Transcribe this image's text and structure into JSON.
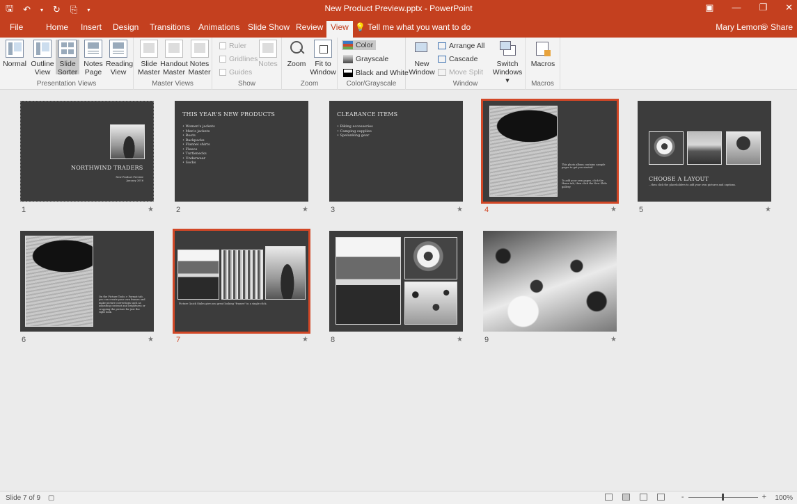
{
  "title_bar": {
    "title": "New Product Preview.pptx - PowerPoint",
    "qat_icons": [
      "save-icon",
      "undo-icon",
      "redo-icon",
      "start-from-beginning-icon",
      "customize-qat-icon"
    ],
    "qat_glyphs": {
      "save": "🖫",
      "undo": "↶",
      "undo_more": "▾",
      "redo": "↻",
      "present": "⎘",
      "customize": "▾"
    },
    "win_glyphs": {
      "ribbon": "▣",
      "minimize": "—",
      "restore": "❐",
      "close": "✕"
    }
  },
  "tabs": {
    "items": [
      "File",
      "Home",
      "Insert",
      "Design",
      "Transitions",
      "Animations",
      "Slide Show",
      "Review",
      "View"
    ],
    "active": "View",
    "tell_me": "Tell me what you want to do",
    "user": "Mary Lemons",
    "share": "Share"
  },
  "ribbon": {
    "presentation_views": {
      "label": "Presentation Views",
      "normal": "Normal",
      "outline": [
        "Outline",
        "View"
      ],
      "slide_sorter": [
        "Slide",
        "Sorter"
      ],
      "notes_page": [
        "Notes",
        "Page"
      ],
      "reading": [
        "Reading",
        "View"
      ]
    },
    "master_views": {
      "label": "Master Views",
      "slide": [
        "Slide",
        "Master"
      ],
      "handout": [
        "Handout",
        "Master"
      ],
      "notes": [
        "Notes",
        "Master"
      ]
    },
    "show": {
      "label": "Show",
      "ruler": "Ruler",
      "gridlines": "Gridlines",
      "guides": "Guides",
      "notes": "Notes"
    },
    "zoom": {
      "label": "Zoom",
      "zoom": "Zoom",
      "fit": [
        "Fit to",
        "Window"
      ]
    },
    "color_grayscale": {
      "label": "Color/Grayscale",
      "color": "Color",
      "grayscale": "Grayscale",
      "bw": "Black and White"
    },
    "window": {
      "label": "Window",
      "new_window": [
        "New",
        "Window"
      ],
      "arrange_all": "Arrange All",
      "cascade": "Cascade",
      "move_split": "Move Split",
      "switch": [
        "Switch",
        "Windows ▾"
      ]
    },
    "macros": {
      "label": "Macros",
      "macros": "Macros"
    }
  },
  "slides": [
    {
      "number": "1",
      "title": "NORTHWIND TRADERS",
      "subtitle1": "New Product Preview",
      "subtitle2": "January 2016"
    },
    {
      "number": "2",
      "title": "THIS YEAR'S NEW PRODUCTS",
      "bullets": [
        "Women's jackets",
        "Men's jackets",
        "Boots",
        "Backpacks",
        "Flannel shirts",
        "Fleece",
        "Turtlenecks",
        "Underwear",
        "Socks"
      ]
    },
    {
      "number": "3",
      "title": "CLEARANCE ITEMS",
      "bullets": [
        "Biking accessories",
        "Camping supplies",
        "Spelunking gear"
      ]
    },
    {
      "number": "4",
      "text1": "This photo album contains sample pages to get you started.",
      "text2": "To add your own pages, click the Home tab, then click the New Slide gallery."
    },
    {
      "number": "5",
      "title": "CHOOSE A LAYOUT",
      "caption": "...then click the placeholders to add your own pictures and captions."
    },
    {
      "number": "6",
      "text1": "On the Picture Tools > Format tab, you can create your own frames and make picture corrections such as adjusting contrast and brightness or cropping the picture for just the right look."
    },
    {
      "number": "7",
      "caption": "Picture Quick Styles give you great looking \"frames\" in a single click."
    },
    {
      "number": "8"
    },
    {
      "number": "9"
    }
  ],
  "selected_slides": [
    "4",
    "7"
  ],
  "status_bar": {
    "slide_info": "Slide 7 of 9",
    "zoom_minus": "-",
    "zoom_plus": "+",
    "zoom_percent": "100%"
  }
}
